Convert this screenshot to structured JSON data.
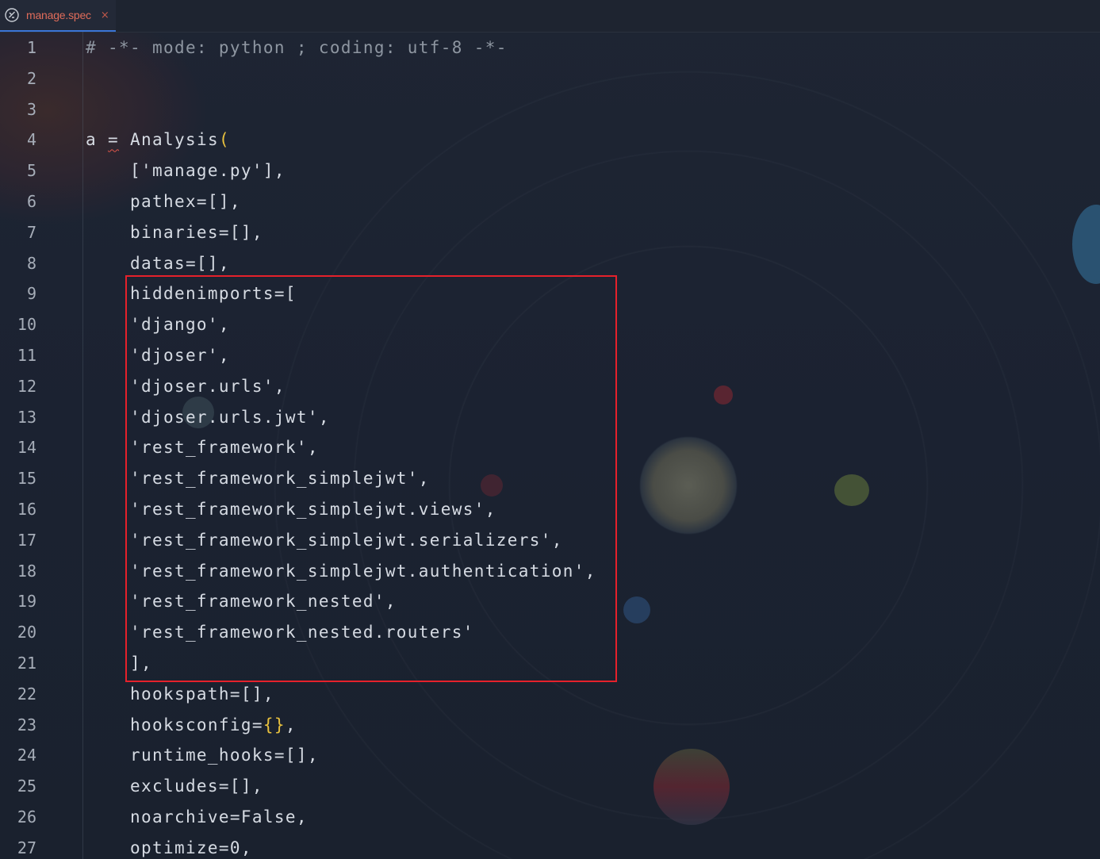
{
  "tab": {
    "icon": "pyinstaller-spec-icon",
    "label": "manage.spec",
    "close_glyph": "×"
  },
  "editor": {
    "lines": [
      {
        "num": "1",
        "text": "# -*- mode: python ; coding: utf-8 -*-"
      },
      {
        "num": "2",
        "text": ""
      },
      {
        "num": "3",
        "text": ""
      },
      {
        "num": "4",
        "text": "a = Analysis("
      },
      {
        "num": "5",
        "text": "    ['manage.py'],"
      },
      {
        "num": "6",
        "text": "    pathex=[],"
      },
      {
        "num": "7",
        "text": "    binaries=[],"
      },
      {
        "num": "8",
        "text": "    datas=[],"
      },
      {
        "num": "9",
        "text": "    hiddenimports=["
      },
      {
        "num": "10",
        "text": "    'django',"
      },
      {
        "num": "11",
        "text": "    'djoser',"
      },
      {
        "num": "12",
        "text": "    'djoser.urls',"
      },
      {
        "num": "13",
        "text": "    'djoser.urls.jwt',"
      },
      {
        "num": "14",
        "text": "    'rest_framework',"
      },
      {
        "num": "15",
        "text": "    'rest_framework_simplejwt',"
      },
      {
        "num": "16",
        "text": "    'rest_framework_simplejwt.views',"
      },
      {
        "num": "17",
        "text": "    'rest_framework_simplejwt.serializers',"
      },
      {
        "num": "18",
        "text": "    'rest_framework_simplejwt.authentication',"
      },
      {
        "num": "19",
        "text": "    'rest_framework_nested',"
      },
      {
        "num": "20",
        "text": "    'rest_framework_nested.routers'"
      },
      {
        "num": "21",
        "text": "    ],"
      },
      {
        "num": "22",
        "text": "    hookspath=[],"
      },
      {
        "num": "23",
        "text": "    hooksconfig={},"
      },
      {
        "num": "24",
        "text": "    runtime_hooks=[],"
      },
      {
        "num": "25",
        "text": "    excludes=[],"
      },
      {
        "num": "26",
        "text": "    noarchive=False,"
      },
      {
        "num": "27",
        "text": "    optimize=0,"
      }
    ]
  },
  "colors": {
    "background": "#1b2231",
    "text": "#d6dbe3",
    "comment": "#8e96a1",
    "brace": "#e8c13e",
    "tab_label": "#e06c5a",
    "highlight_border": "#e5212b",
    "tab_underline": "#3b74d6"
  }
}
